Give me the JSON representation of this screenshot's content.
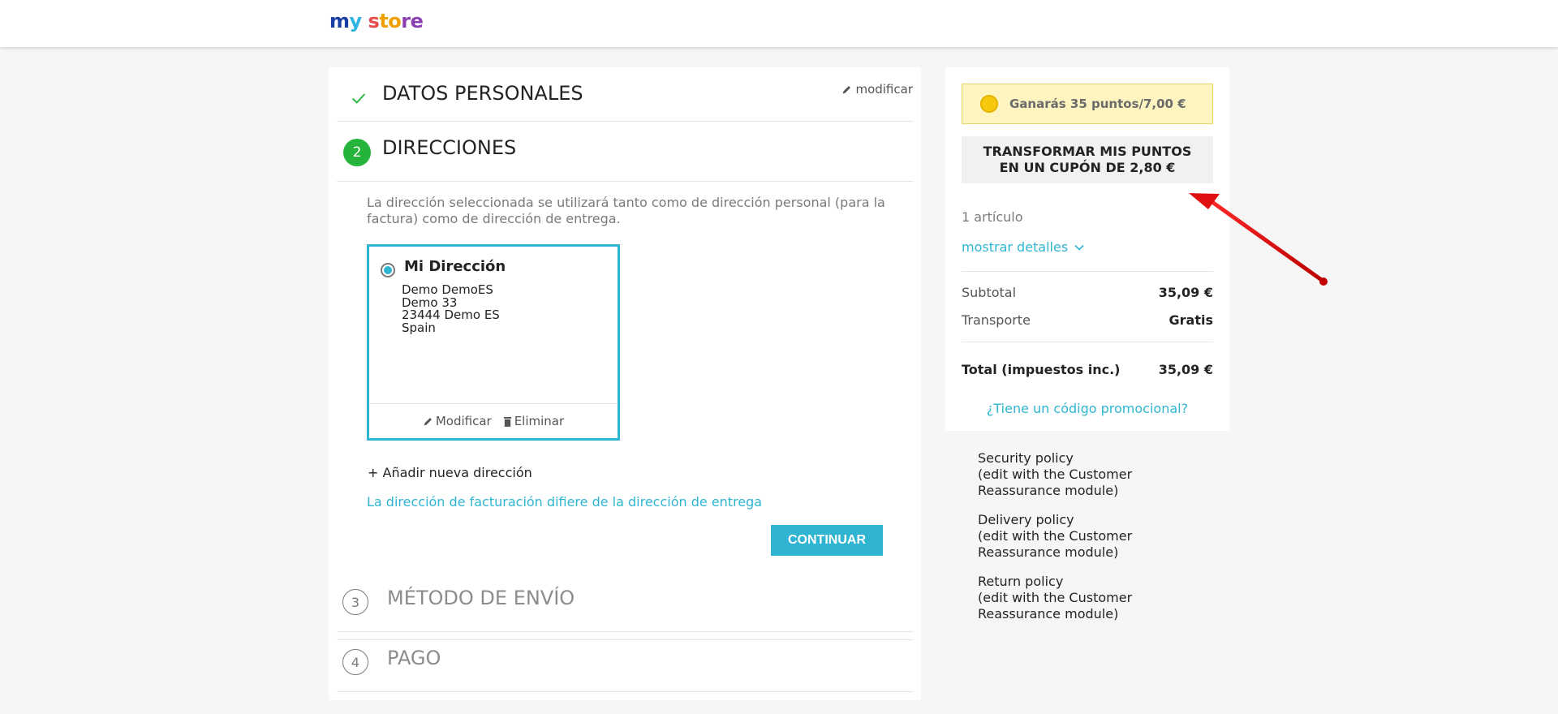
{
  "header": {
    "logo": {
      "p1": "m",
      "p2": "y",
      "p3": " s",
      "p4": "to",
      "p5": "re"
    }
  },
  "steps": {
    "personal": {
      "title": "DATOS PERSONALES",
      "modify_label": "modificar"
    },
    "addresses": {
      "number": "2",
      "title": "DIRECCIONES",
      "description": "La dirección seleccionada se utilizará tanto como de dirección personal (para la factura) como de dirección de entrega.",
      "address": {
        "alias": "Mi Dirección",
        "lines": [
          "Demo DemoES",
          "Demo 33",
          "23444 Demo ES",
          "Spain"
        ],
        "edit_label": "Modificar",
        "delete_label": "Eliminar"
      },
      "add_new_label": "+ Añadir nueva dirección",
      "billing_link": "La dirección de facturación difiere de la dirección de entrega",
      "continue_label": "CONTINUAR"
    },
    "shipping": {
      "number": "3",
      "title": "MÉTODO DE ENVÍO"
    },
    "payment": {
      "number": "4",
      "title": "PAGO"
    }
  },
  "cart": {
    "points_text": "Ganarás 35 puntos/7,00 €",
    "transform_label": "TRANSFORMAR MIS PUNTOS EN UN CUPÓN DE 2,80 €",
    "items_count": "1 artículo",
    "show_details": "mostrar detalles",
    "subtotal_label": "Subtotal",
    "subtotal_value": "35,09 €",
    "shipping_label": "Transporte",
    "shipping_value": "Gratis",
    "total_label": "Total (impuestos inc.)",
    "total_value": "35,09 €",
    "promo_label": "¿Tiene un código promocional?"
  },
  "reassurance": [
    {
      "title": "Security policy",
      "body": "(edit with the Customer Reassurance module)"
    },
    {
      "title": "Delivery policy",
      "body": "(edit with the Customer Reassurance module)"
    },
    {
      "title": "Return policy",
      "body": "(edit with the Customer Reassurance module)"
    }
  ],
  "colors": {
    "accent": "#2fb5d2",
    "success": "#24b43a",
    "arrow": "#e01010"
  }
}
